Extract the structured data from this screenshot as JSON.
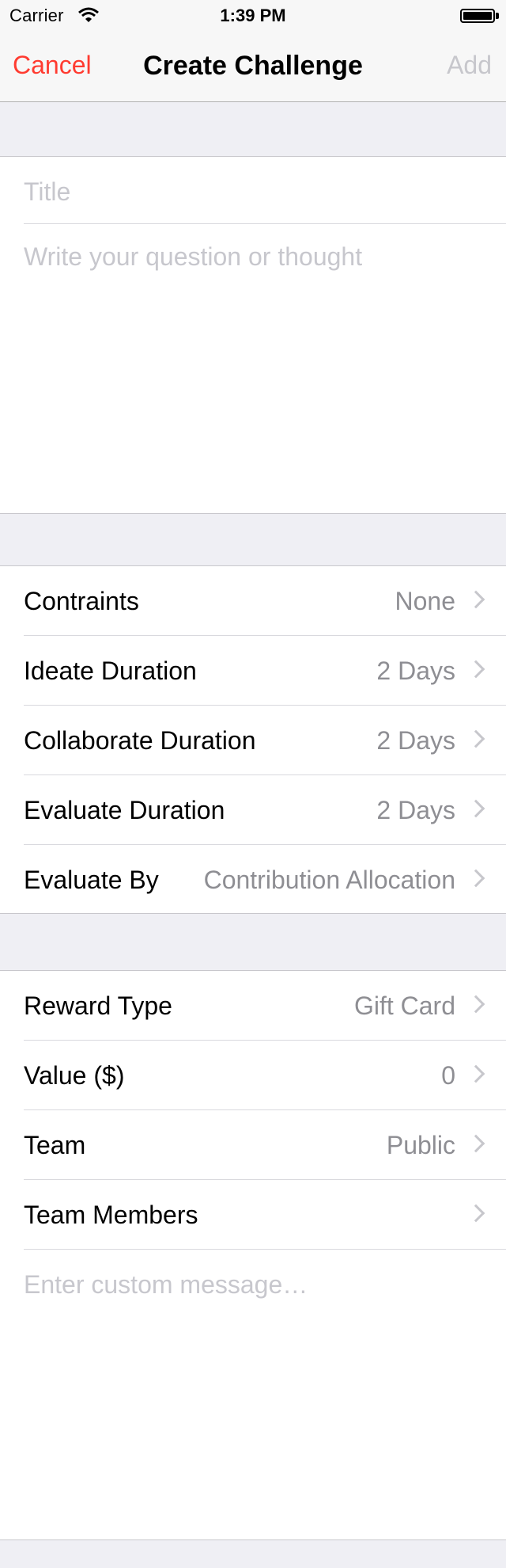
{
  "status_bar": {
    "carrier": "Carrier",
    "time": "1:39 PM"
  },
  "nav": {
    "cancel": "Cancel",
    "title": "Create Challenge",
    "add": "Add"
  },
  "compose": {
    "title_placeholder": "Title",
    "body_placeholder": "Write your question or thought"
  },
  "settings": [
    {
      "label": "Contraints",
      "value": "None"
    },
    {
      "label": "Ideate Duration",
      "value": "2 Days"
    },
    {
      "label": "Collaborate Duration",
      "value": "2 Days"
    },
    {
      "label": "Evaluate Duration",
      "value": "2 Days"
    },
    {
      "label": "Evaluate By",
      "value": "Contribution Allocation"
    }
  ],
  "reward": [
    {
      "label": "Reward Type",
      "value": "Gift Card"
    },
    {
      "label": "Value ($)",
      "value": "0"
    },
    {
      "label": "Team",
      "value": "Public"
    },
    {
      "label": "Team Members",
      "value": ""
    }
  ],
  "message": {
    "placeholder": "Enter custom message…"
  },
  "colors": {
    "accent_red": "#ff3b30",
    "disabled": "#c7c7cc",
    "secondary_text": "#8e8e93",
    "group_background": "#efeff4"
  }
}
